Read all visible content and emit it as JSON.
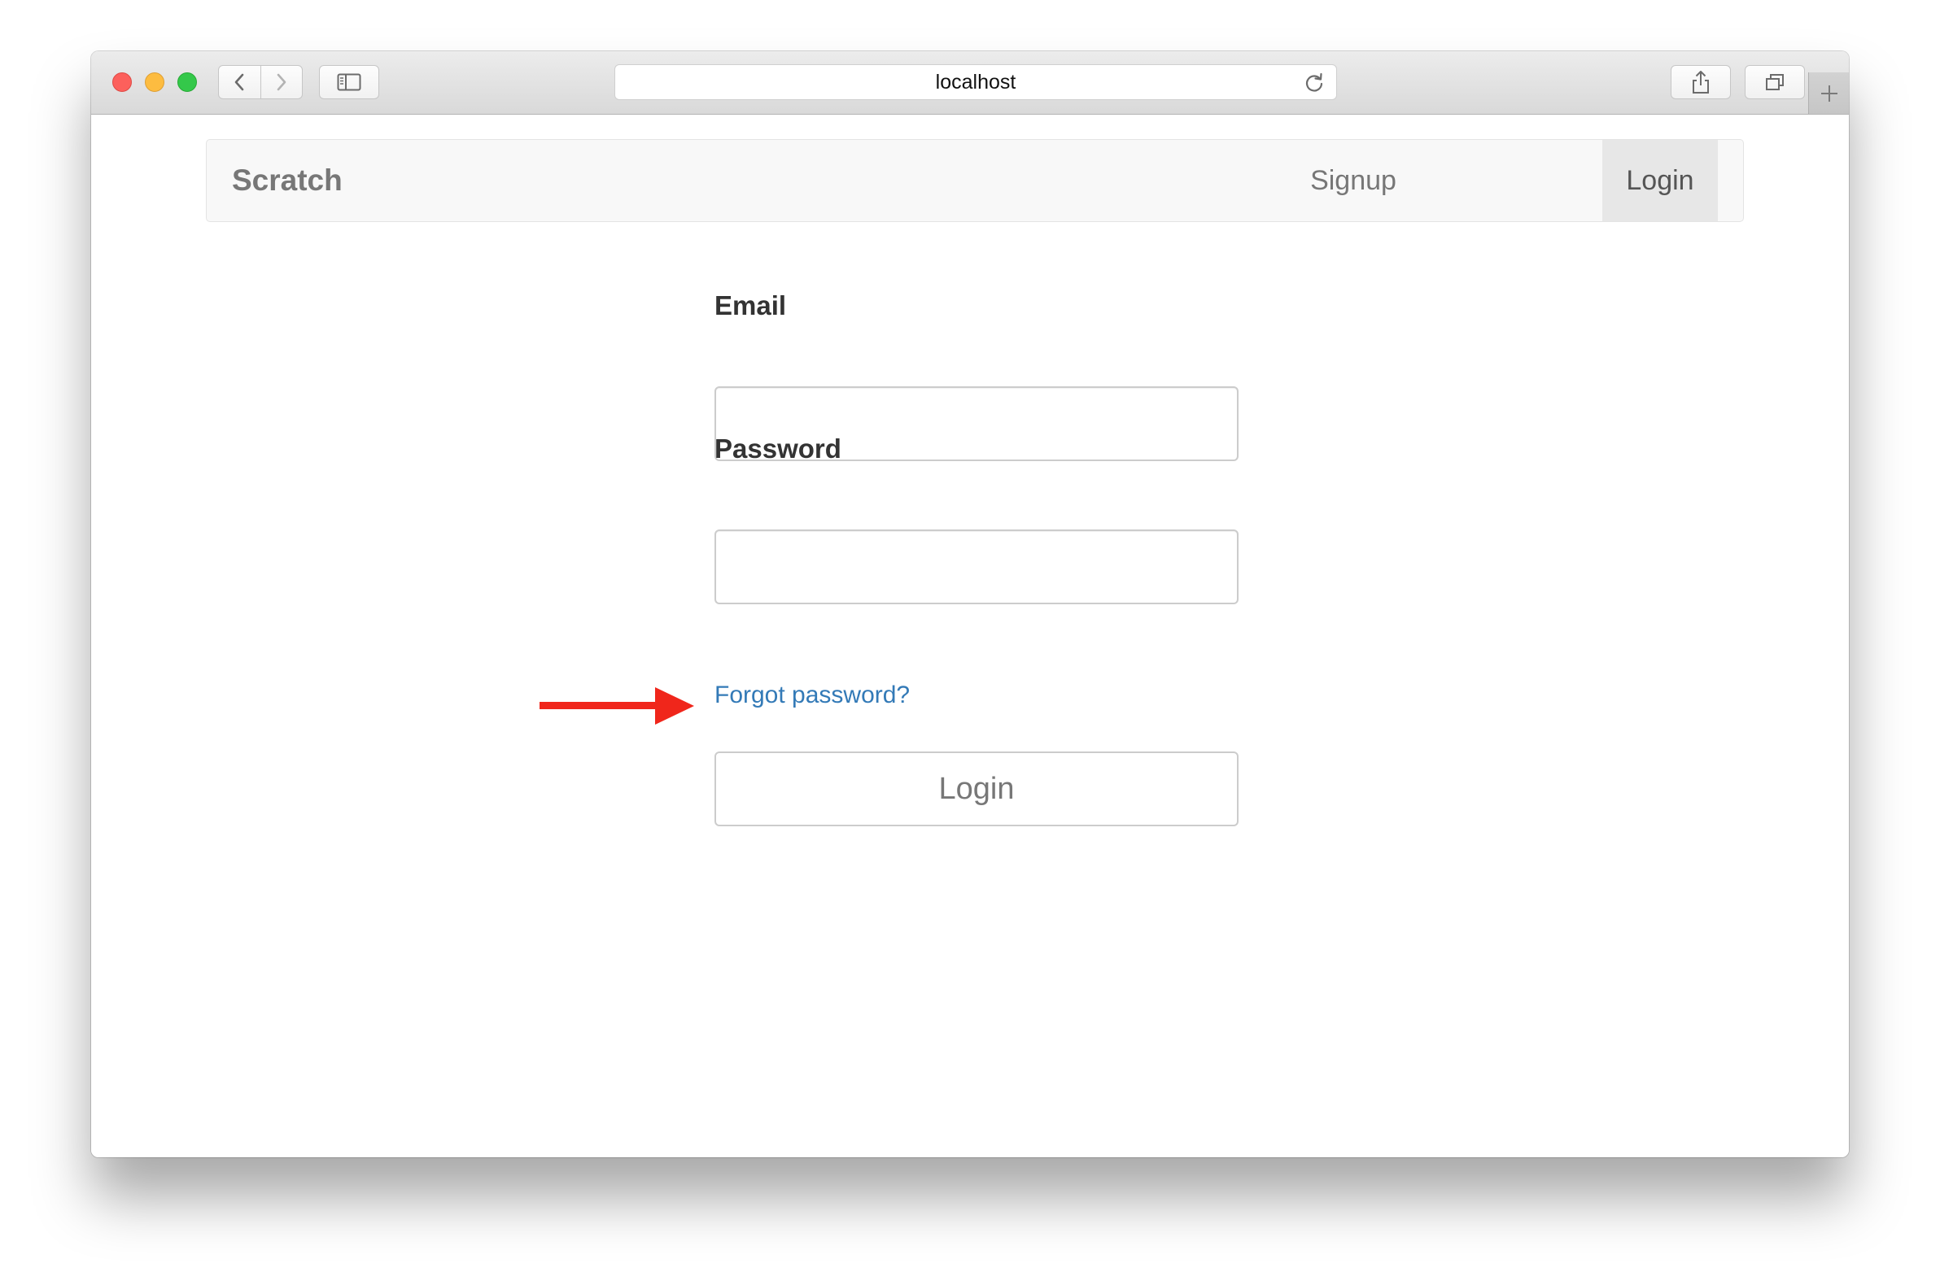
{
  "browser": {
    "address": "localhost"
  },
  "navbar": {
    "brand": "Scratch",
    "links": [
      {
        "label": "Signup",
        "active": false
      },
      {
        "label": "Login",
        "active": true
      }
    ]
  },
  "form": {
    "email_label": "Email",
    "email_value": "",
    "password_label": "Password",
    "password_value": "",
    "forgot_link": "Forgot password?",
    "submit_label": "Login"
  },
  "colors": {
    "link": "#337ab7",
    "annotation_arrow": "#f0261b",
    "navbar_bg": "#f8f8f8",
    "active_nav_bg": "#e7e7e7"
  },
  "icons": [
    "back-chevron-icon",
    "forward-chevron-icon",
    "sidebar-icon",
    "reload-icon",
    "share-icon",
    "tabs-icon",
    "plus-icon",
    "arrow-annotation-icon"
  ]
}
